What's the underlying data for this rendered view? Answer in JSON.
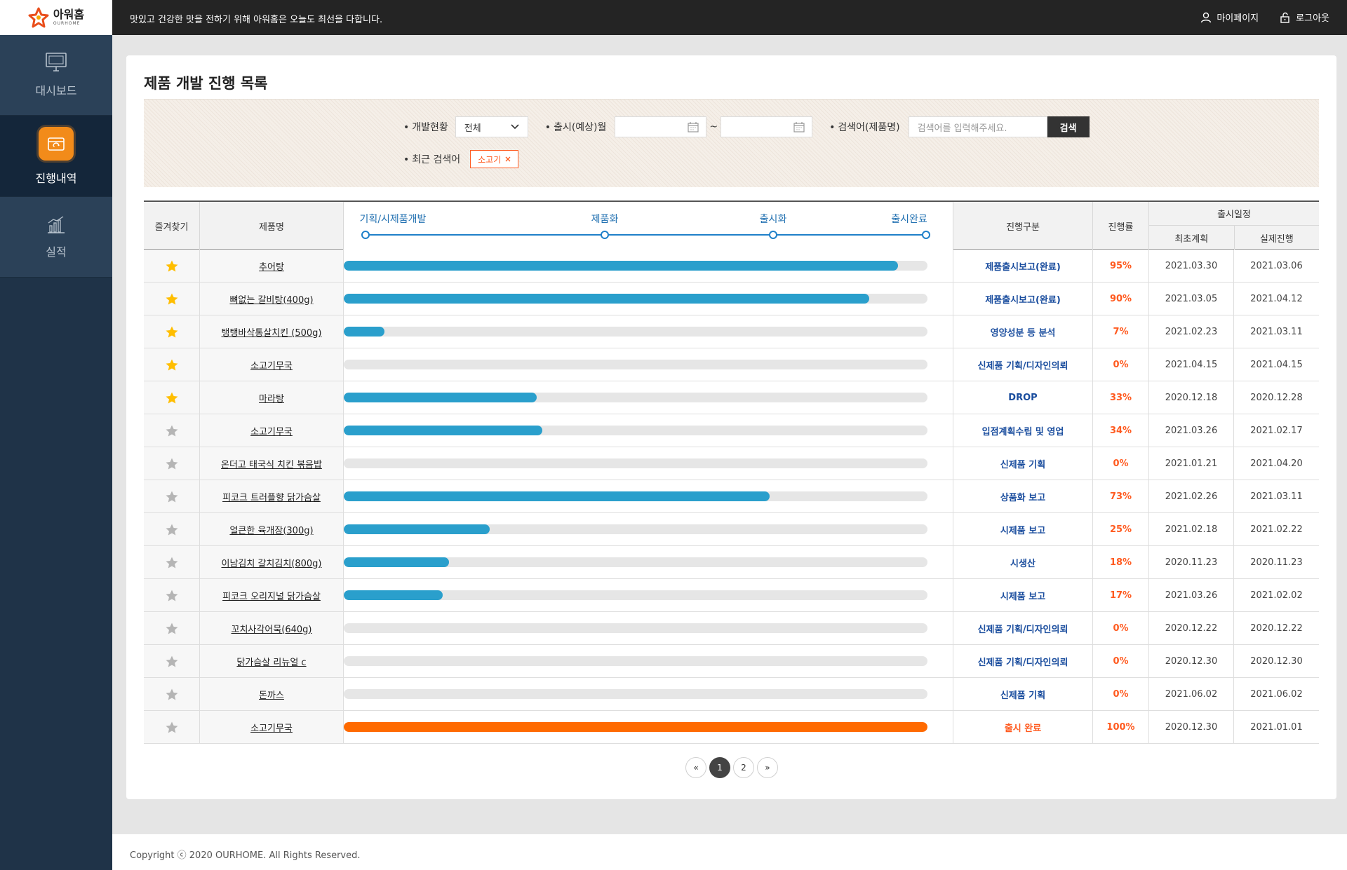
{
  "header": {
    "logo_text": "아워홈",
    "logo_sub": "OURHOME",
    "slogan": "맛있고 건강한 맛을 전하기 위해 아워홈은 오늘도 최선을 다합니다.",
    "mypage_label": "마이페이지",
    "logout_label": "로그아웃"
  },
  "sidebar": {
    "items": [
      {
        "label": "대시보드",
        "icon": "monitor-icon",
        "active": false
      },
      {
        "label": "진행내역",
        "icon": "package-icon",
        "active": true
      },
      {
        "label": "실적",
        "icon": "chart-icon",
        "active": false
      }
    ]
  },
  "page": {
    "title": "제품 개발 진행 목록"
  },
  "filter": {
    "status_label": "개발현황",
    "status_value": "전체",
    "release_label": "출시(예상)월",
    "date_separator": "~",
    "keyword_label": "검색어(제품명)",
    "keyword_placeholder": "검색어를 입력해주세요.",
    "search_button": "검색",
    "recent_label": "최근 검색어",
    "recent_tag": "소고기"
  },
  "table": {
    "headers": {
      "favorite": "즐겨찾기",
      "name": "제품명",
      "status": "진행구분",
      "rate": "진행률",
      "schedule": "출시일정",
      "plan": "최초계획",
      "actual": "실제진행"
    },
    "milestones": [
      "기획/시제품개발",
      "제품화",
      "출시화",
      "출시완료"
    ],
    "rows": [
      {
        "fav": true,
        "name": "추어탕",
        "progress": 0.95,
        "status": "제품출시보고(완료)",
        "rate": "95%",
        "plan": "2021.03.30",
        "actual": "2021.03.06"
      },
      {
        "fav": true,
        "name": "뼈없는 갈비탕(400g)",
        "progress": 0.9,
        "status": "제품출시보고(완료)",
        "rate": "90%",
        "plan": "2021.03.05",
        "actual": "2021.04.12"
      },
      {
        "fav": true,
        "name": "탱탱바삭통살치킨 (500g)",
        "progress": 0.07,
        "status": "영양성분 등 분석",
        "rate": "7%",
        "plan": "2021.02.23",
        "actual": "2021.03.11"
      },
      {
        "fav": true,
        "name": "소고기무국",
        "progress": 0.0,
        "status": "신제품 기획/디자인의뢰",
        "rate": "0%",
        "plan": "2021.04.15",
        "actual": "2021.04.15"
      },
      {
        "fav": true,
        "name": "마라탕",
        "progress": 0.33,
        "status": "DROP",
        "rate": "33%",
        "plan": "2020.12.18",
        "actual": "2020.12.28"
      },
      {
        "fav": false,
        "name": "소고기무국",
        "progress": 0.34,
        "status": "입점계획수립 및 영업",
        "rate": "34%",
        "plan": "2021.03.26",
        "actual": "2021.02.17"
      },
      {
        "fav": false,
        "name": "온더고 태국식 치킨 볶음밥",
        "progress": 0.0,
        "status": "신제품 기획",
        "rate": "0%",
        "plan": "2021.01.21",
        "actual": "2021.04.20"
      },
      {
        "fav": false,
        "name": "피코크 트러플향 닭가슴살",
        "progress": 0.73,
        "status": "상품화 보고",
        "rate": "73%",
        "plan": "2021.02.26",
        "actual": "2021.03.11"
      },
      {
        "fav": false,
        "name": "얼큰한 육개장(300g)",
        "progress": 0.25,
        "status": "시제품 보고",
        "rate": "25%",
        "plan": "2021.02.18",
        "actual": "2021.02.22"
      },
      {
        "fav": false,
        "name": "이남김치 갈치김치(800g)",
        "progress": 0.18,
        "status": "시생산",
        "rate": "18%",
        "plan": "2020.11.23",
        "actual": "2020.11.23"
      },
      {
        "fav": false,
        "name": "피코크 오리지널 닭가슴살",
        "progress": 0.17,
        "status": "시제품 보고",
        "rate": "17%",
        "plan": "2021.03.26",
        "actual": "2021.02.02"
      },
      {
        "fav": false,
        "name": "꼬치사각어묵(640g)",
        "progress": 0.0,
        "status": "신제품 기획/디자인의뢰",
        "rate": "0%",
        "plan": "2020.12.22",
        "actual": "2020.12.22"
      },
      {
        "fav": false,
        "name": "닭가슴살 리뉴얼 c",
        "progress": 0.0,
        "status": "신제품 기획/디자인의뢰",
        "rate": "0%",
        "plan": "2020.12.30",
        "actual": "2020.12.30"
      },
      {
        "fav": false,
        "name": "돈까스",
        "progress": 0.0,
        "status": "신제품 기획",
        "rate": "0%",
        "plan": "2021.06.02",
        "actual": "2021.06.02"
      },
      {
        "fav": false,
        "name": "소고기무국",
        "progress": 1.0,
        "status": "출시 완료",
        "rate": "100%",
        "plan": "2020.12.30",
        "actual": "2021.01.01"
      }
    ]
  },
  "pagination": {
    "prev": "«",
    "pages": [
      "1",
      "2"
    ],
    "current": "1",
    "next": "»"
  },
  "footer": {
    "copyright": "Copyright ⓒ 2020 OURHOME. All Rights Reserved."
  },
  "colors": {
    "bar_blue": "#2a9fcc",
    "bar_complete": "#ff6a00",
    "star_on": "#ffbe00",
    "star_off": "#b5b5b5",
    "accent": "#ff5a1f",
    "status_blue": "#1a4d9e"
  }
}
